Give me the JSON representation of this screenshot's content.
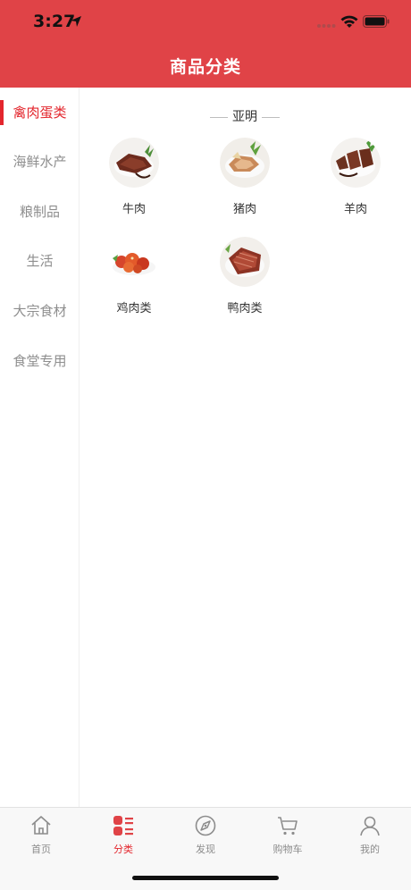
{
  "status_bar": {
    "time": "3:27"
  },
  "header": {
    "title": "商品分类"
  },
  "sidebar": {
    "items": [
      {
        "label": "禽肉蛋类",
        "active": true
      },
      {
        "label": "海鲜水产",
        "active": false
      },
      {
        "label": "粮制品",
        "active": false
      },
      {
        "label": "生活",
        "active": false
      },
      {
        "label": "大宗食材",
        "active": false
      },
      {
        "label": "食堂专用",
        "active": false
      }
    ]
  },
  "main": {
    "section_title": "亚明",
    "products": [
      {
        "label": "牛肉"
      },
      {
        "label": "猪肉"
      },
      {
        "label": "羊肉"
      },
      {
        "label": "鸡肉类"
      },
      {
        "label": "鸭肉类"
      }
    ]
  },
  "tabbar": {
    "tabs": [
      {
        "label": "首页",
        "icon": "home-icon",
        "active": false
      },
      {
        "label": "分类",
        "icon": "category-icon",
        "active": true
      },
      {
        "label": "发现",
        "icon": "discover-icon",
        "active": false
      },
      {
        "label": "购物车",
        "icon": "cart-icon",
        "active": false
      },
      {
        "label": "我的",
        "icon": "profile-icon",
        "active": false
      }
    ]
  },
  "colors": {
    "brand": "#e04347",
    "active_text": "#e3262d",
    "inactive_text": "#8e8e8e"
  }
}
